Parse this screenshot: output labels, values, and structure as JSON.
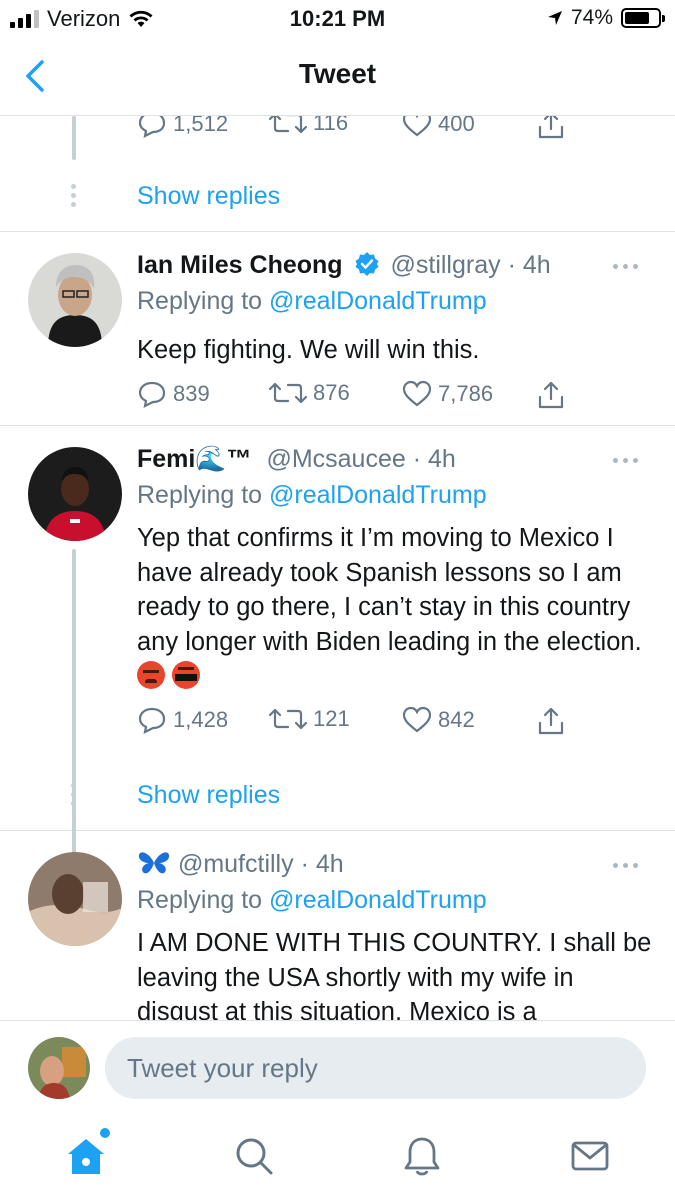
{
  "status_bar": {
    "carrier": "Verizon",
    "time": "10:21 PM",
    "battery_percent": "74%",
    "battery_level": 0.74
  },
  "nav": {
    "title": "Tweet",
    "back_icon": "chevron-left-icon"
  },
  "colors": {
    "accent": "#1da1f2",
    "text": "#14171a",
    "secondary": "#657786",
    "divider": "#dfe3e7"
  },
  "top_partial": {
    "reply_count": "1,512",
    "retweet_count": "116",
    "like_count": "400",
    "show_replies": "Show replies"
  },
  "tweets": [
    {
      "name": "Ian Miles Cheong",
      "verified": true,
      "handle": "@stillgray",
      "time": "· 4h",
      "replying_prefix": "Replying to",
      "replying_to": "@realDonaldTrump",
      "text": "Keep fighting. We will win this.",
      "reply_count": "839",
      "retweet_count": "876",
      "like_count": "7,786"
    },
    {
      "name": "Femi🌊™",
      "handle": "@Mcsaucee",
      "time": "· 4h",
      "replying_prefix": "Replying to",
      "replying_to": "@realDonaldTrump",
      "text": "Yep that confirms it I’m moving to Mexico I have already took Spanish lessons so I am ready to go there, I can’t stay in this country any longer with Biden leading in the election.",
      "emojis": [
        "angry-face-icon",
        "cursing-face-icon"
      ],
      "reply_count": "1,428",
      "retweet_count": "121",
      "like_count": "842",
      "show_replies": "Show replies"
    },
    {
      "name_icon": "butterfly-icon",
      "handle": "@mufctilly",
      "time": "· 4h",
      "replying_prefix": "Replying to",
      "replying_to": "@realDonaldTrump",
      "text": "I AM DONE WITH THIS COUNTRY.  I shall be leaving the USA shortly with my wife in disgust at this situation.  Mexico is a"
    }
  ],
  "composer": {
    "placeholder": "Tweet your reply"
  },
  "tabs": [
    "home-icon",
    "search-icon",
    "notifications-icon",
    "messages-icon"
  ]
}
